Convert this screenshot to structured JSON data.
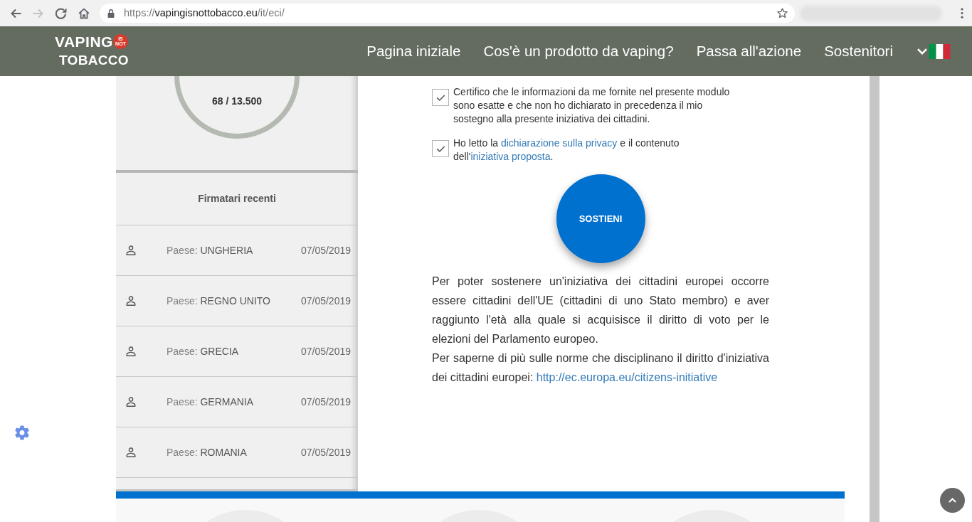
{
  "browser": {
    "nav_buttons": [
      {
        "kind": "back",
        "disabled": false
      },
      {
        "kind": "forward",
        "disabled": true
      },
      {
        "kind": "reload",
        "disabled": false
      },
      {
        "kind": "home",
        "disabled": false
      }
    ],
    "url": {
      "scheme": "https://",
      "host": "vapingisnottobacco.eu",
      "path": "/it/eci/"
    }
  },
  "header": {
    "logo": {
      "top": "VAPING",
      "badge": "IS NOT",
      "bottom": "TOBACCO"
    },
    "nav": [
      {
        "label": "Pagina iniziale"
      },
      {
        "label": "Cos'è un prodotto da vaping?"
      },
      {
        "label": "Passa all'azione"
      },
      {
        "label": "Sostenitori"
      }
    ]
  },
  "signatures": {
    "count": "68 / 13.500"
  },
  "recent_signers": {
    "title": "Firmatari recenti",
    "rows": [
      {
        "label": "Paese:",
        "country": "UNGHERIA",
        "date": "07/05/2019"
      },
      {
        "label": "Paese:",
        "country": "REGNO UNITO",
        "date": "07/05/2019"
      },
      {
        "label": "Paese:",
        "country": "GRECIA",
        "date": "07/05/2019"
      },
      {
        "label": "Paese:",
        "country": "GERMANIA",
        "date": "07/05/2019"
      },
      {
        "label": "Paese:",
        "country": "ROMANIA",
        "date": "07/05/2019"
      }
    ]
  },
  "consents": [
    {
      "checked": true,
      "parts": [
        {
          "kind": "text",
          "text": "Certifico che le informazioni da me fornite nel presente modulo sono esatte e che non ho dichiarato in precedenza il mio sostegno alla presente iniziativa dei cittadini."
        }
      ]
    },
    {
      "checked": true,
      "parts": [
        {
          "kind": "text",
          "text": "Ho letto la "
        },
        {
          "kind": "link",
          "text": "dichiarazione sulla privacy"
        },
        {
          "kind": "text",
          "text": " e il contenuto dell'"
        },
        {
          "kind": "link",
          "text": "iniziativa proposta"
        },
        {
          "kind": "text",
          "text": "."
        }
      ]
    }
  ],
  "support_button": {
    "label": "SOSTIENI"
  },
  "info": [
    {
      "parts": [
        {
          "kind": "text",
          "text": "Per poter sostenere un'iniziativa dei cittadini europei occorre essere cittadini dell'UE (cittadini di uno Stato membro) e aver raggiunto l'età alla quale si acquisisce il diritto di voto per le elezioni del Parlamento europeo."
        }
      ]
    },
    {
      "parts": [
        {
          "kind": "text",
          "text": "Per saperne di più sulle norme che disciplinano il diritto d'iniziativa dei cittadini europei: "
        },
        {
          "kind": "link",
          "text": "http://ec.europa.eu/citizens-initiative"
        }
      ]
    }
  ]
}
